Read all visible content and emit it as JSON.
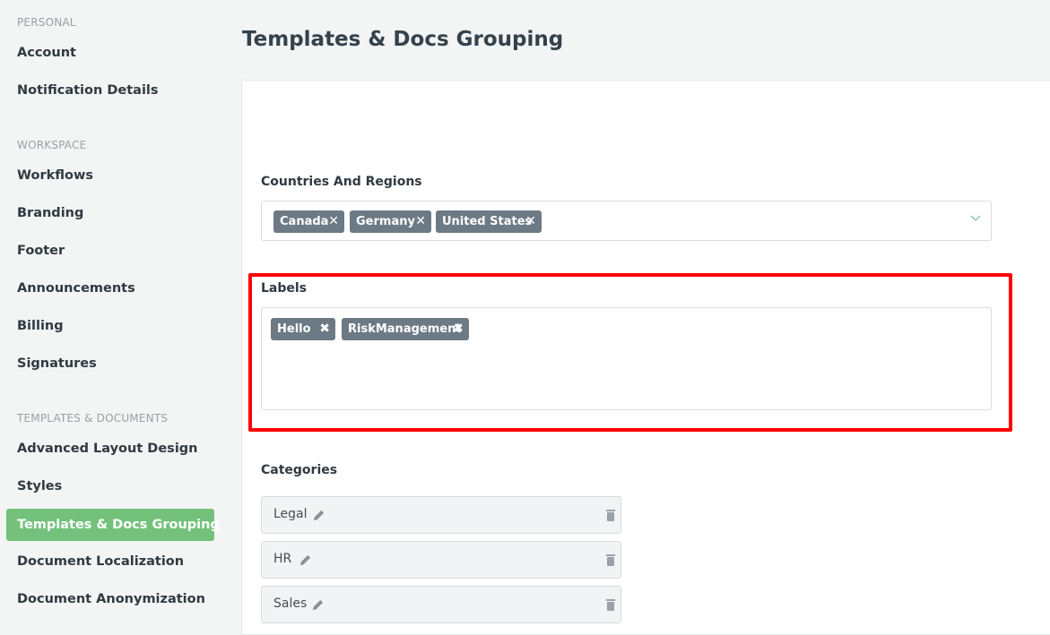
{
  "sidebar": {
    "sections": [
      {
        "title": "PERSONAL",
        "items": [
          "Account",
          "Notification Details"
        ]
      },
      {
        "title": "WORKSPACE",
        "items": [
          "Workflows",
          "Branding",
          "Footer",
          "Announcements",
          "Billing",
          "Signatures"
        ]
      },
      {
        "title": "TEMPLATES & DOCUMENTS",
        "items": [
          "Advanced Layout Design",
          "Styles",
          "Templates & Docs Grouping",
          "Document Localization",
          "Document Anonymization"
        ]
      }
    ],
    "active_item": "Templates & Docs Grouping"
  },
  "page": {
    "title": "Templates & Docs Grouping"
  },
  "countries": {
    "label": "Countries And Regions",
    "tags": [
      "Canada",
      "Germany",
      "United States"
    ]
  },
  "labels": {
    "label": "Labels",
    "tags": [
      "Hello",
      "RiskManagement"
    ]
  },
  "categories": {
    "label": "Categories",
    "items": [
      "Legal",
      "HR",
      "Sales"
    ]
  },
  "colors": {
    "accent": "#74c17c",
    "tag_bg": "#6c7a85",
    "highlight": "#ff0000"
  },
  "icons": {
    "tag_remove": "close-icon",
    "dropdown": "chevron-down-icon",
    "edit": "pencil-icon",
    "delete": "trash-icon"
  }
}
